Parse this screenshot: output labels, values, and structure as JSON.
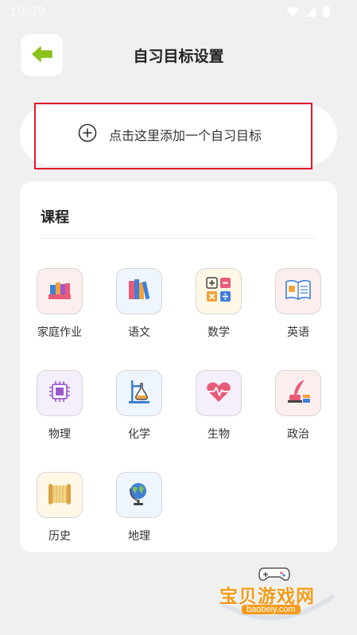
{
  "status_bar": {
    "time": "10:39",
    "icons": [
      "wifi-icon",
      "signal-icon",
      "battery-icon"
    ]
  },
  "header": {
    "title": "自习目标设置",
    "back_icon": "arrow-left-icon",
    "accent_color": "#8bc21c"
  },
  "add_goal": {
    "label": "点击这里添加一个自习目标",
    "icon": "plus-circle-icon"
  },
  "courses": {
    "title": "课程",
    "items": [
      {
        "label": "家庭作业",
        "icon": "books-stack-icon",
        "bg": "#fdeeee"
      },
      {
        "label": "语文",
        "icon": "books-shelf-icon",
        "bg": "#eef5fd"
      },
      {
        "label": "数学",
        "icon": "math-symbols-icon",
        "bg": "#fff8e6"
      },
      {
        "label": "英语",
        "icon": "open-book-icon",
        "bg": "#fdeeee"
      },
      {
        "label": "物理",
        "icon": "circuit-chip-icon",
        "bg": "#f5eefb"
      },
      {
        "label": "化学",
        "icon": "flask-stand-icon",
        "bg": "#eef5fd"
      },
      {
        "label": "生物",
        "icon": "heartbeat-icon",
        "bg": "#f5eefb"
      },
      {
        "label": "政治",
        "icon": "quill-ink-icon",
        "bg": "#fdeeee"
      },
      {
        "label": "历史",
        "icon": "scroll-icon",
        "bg": "#fff8e6"
      },
      {
        "label": "地理",
        "icon": "globe-icon",
        "bg": "#eef5fd"
      }
    ]
  },
  "watermark": {
    "text": "宝贝游戏网",
    "url": "baobeiy.com",
    "icon": "gamepad-icon"
  }
}
